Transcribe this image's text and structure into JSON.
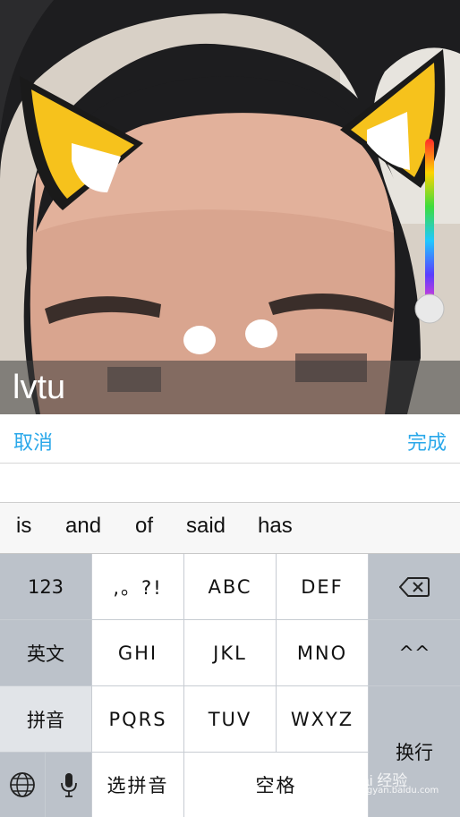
{
  "caption": {
    "text": "lvtu"
  },
  "actions": {
    "cancel": "取消",
    "done": "完成"
  },
  "compose": {
    "value": ""
  },
  "suggestions": [
    "is",
    "and",
    "of",
    "said",
    "has"
  ],
  "keyboard": {
    "row1": {
      "left": "123",
      "k1": ",。?!",
      "k2": "ABC",
      "k3": "DEF",
      "right_icon": "backspace-icon"
    },
    "row2": {
      "left": "英文",
      "k1": "GHI",
      "k2": "JKL",
      "k3": "MNO",
      "right": "^^"
    },
    "row3": {
      "left": "拼音",
      "k1": "PQRS",
      "k2": "TUV",
      "k3": "WXYZ"
    },
    "row4": {
      "globe_icon": "globe-icon",
      "mic_icon": "microphone-icon",
      "select": "选拼音",
      "space": "空格"
    },
    "return": "换行"
  },
  "watermark": {
    "text": "Bai 经验",
    "sub": "jingyan.baidu.com"
  },
  "colors": {
    "accent": "#2aa8ea",
    "ear_yellow": "#f6c21c",
    "key_dark": "#bcc2ca",
    "key_light": "#ffffff"
  }
}
